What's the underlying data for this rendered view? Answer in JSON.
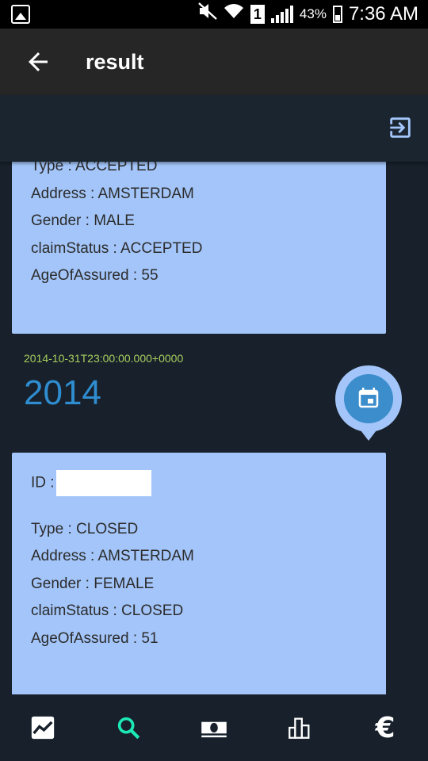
{
  "status_bar": {
    "battery": "43%",
    "sim": "1",
    "time": "7:36 AM"
  },
  "app_bar": {
    "title": "result"
  },
  "records": [
    {
      "type": "Type : ACCEPTED",
      "address": "Address : AMSTERDAM",
      "gender": "Gender : MALE",
      "claim_status": "claimStatus : ACCEPTED",
      "age": "AgeOfAssured : 55"
    },
    {
      "id_label": "ID :",
      "type": "Type : CLOSED",
      "address": "Address : AMSTERDAM",
      "gender": "Gender : FEMALE",
      "claim_status": "claimStatus : CLOSED",
      "age": "AgeOfAssured : 51"
    }
  ],
  "timeline": {
    "timestamp": "2014-10-31T23:00:00.000+0000",
    "year": "2014"
  },
  "bottom_nav": {
    "items": [
      {
        "icon": "trending-chart-icon",
        "active": false
      },
      {
        "icon": "search-icon",
        "active": true
      },
      {
        "icon": "money-icon",
        "active": false
      },
      {
        "icon": "bar-chart-icon",
        "active": false
      },
      {
        "icon": "euro-icon",
        "label": "€",
        "active": false
      }
    ]
  },
  "colors": {
    "background": "#17202b",
    "app_bar": "#262626",
    "card": "#a3c5f9",
    "timestamp": "#a9cf5e",
    "year": "#2f8dcf",
    "active_nav": "#1de9b6"
  }
}
